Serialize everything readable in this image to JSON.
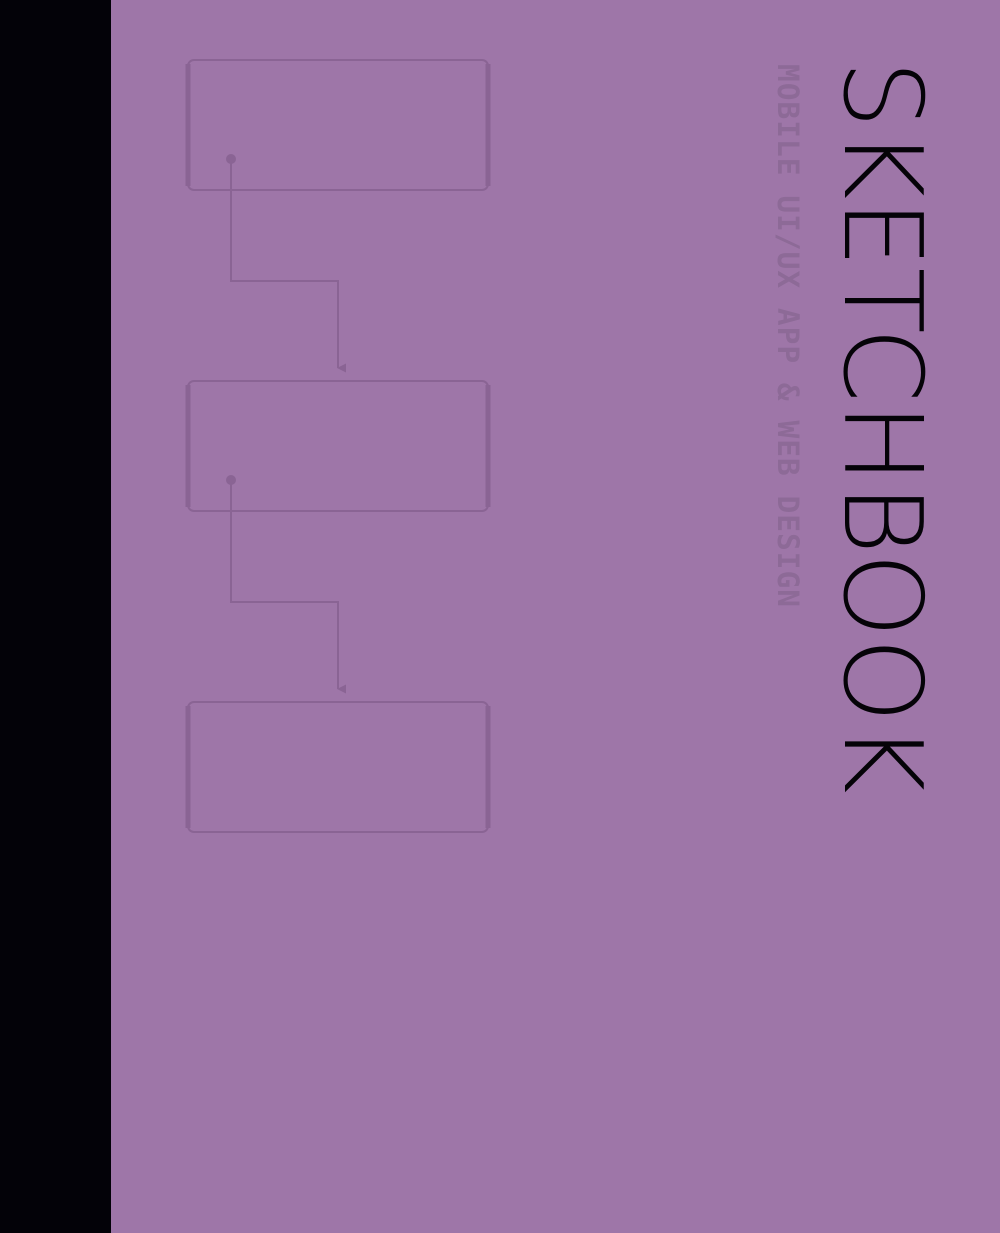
{
  "cover": {
    "title": "SKETCHBOOK",
    "subtitle": "MOBILE UI/UX APP & WEB DESIGN"
  },
  "colors": {
    "background": "#9e76a8",
    "spine": "#030208",
    "title": "#050308",
    "diagram_line": "#8a6494",
    "subtitle": "#8d6a97"
  },
  "diagram": {
    "screens": 3,
    "arrows": 2
  }
}
